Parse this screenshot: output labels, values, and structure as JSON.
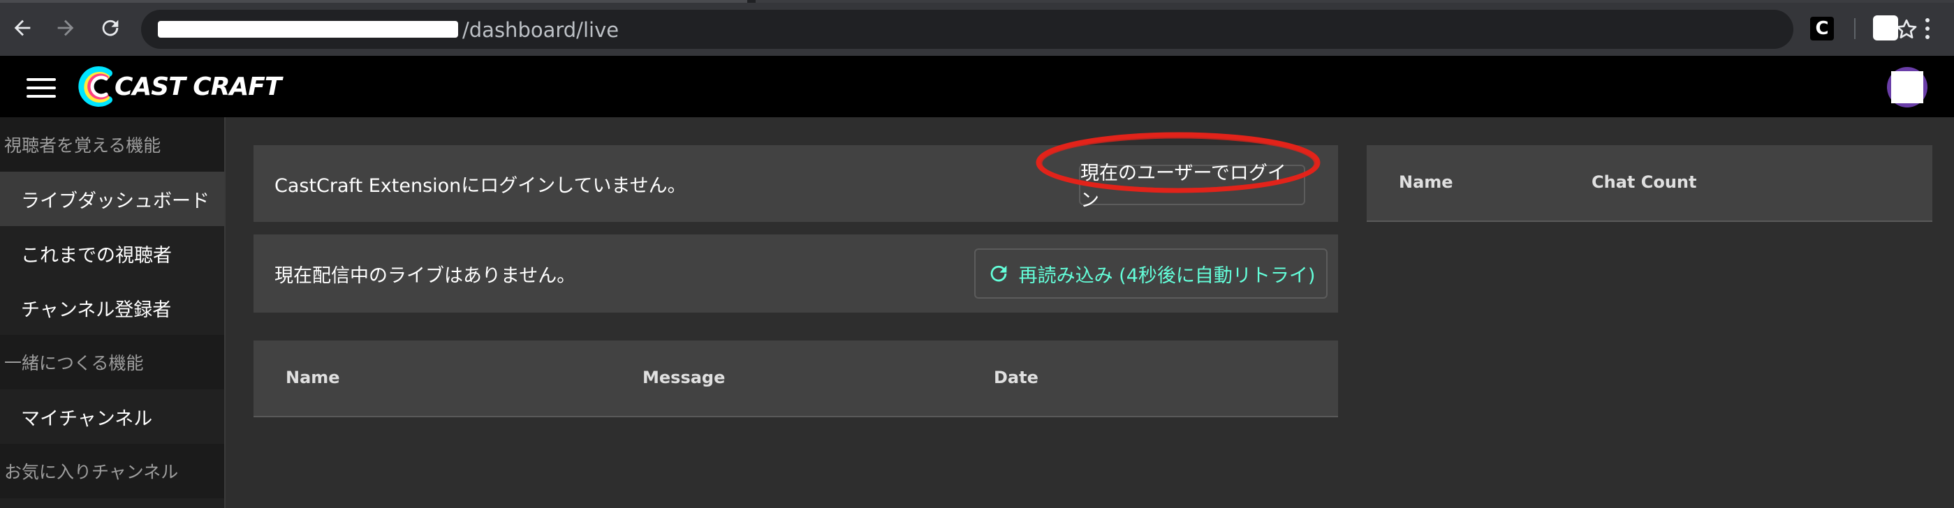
{
  "browser": {
    "url_path": "/dashboard/live",
    "ext_letter": "C"
  },
  "app": {
    "brand": "CAST CRAFT"
  },
  "sidebar": {
    "sections": [
      {
        "title": "視聴者を覚える機能",
        "items": [
          "ライブダッシュボード",
          "これまでの視聴者",
          "チャンネル登録者"
        ]
      },
      {
        "title": "一緒につくる機能",
        "items": [
          "マイチャンネル"
        ]
      },
      {
        "title": "お気に入りチャンネル",
        "items": []
      }
    ],
    "active_item": "ライブダッシュボード"
  },
  "main": {
    "extension_notice": "CastCraft Extensionにログインしていません。",
    "login_button": "現在のユーザーでログイン",
    "live_notice": "現在配信中のライブはありません。",
    "reload_button": "再読み込み (4秒後に自動リトライ)",
    "messages_table": {
      "columns": [
        "Name",
        "Message",
        "Date"
      ]
    },
    "chat_table": {
      "columns": [
        "Name",
        "Chat Count"
      ]
    }
  },
  "colors": {
    "accent_teal": "#64ffda",
    "highlight_red": "#e2231a",
    "avatar_ring": "#6a3ea8"
  }
}
